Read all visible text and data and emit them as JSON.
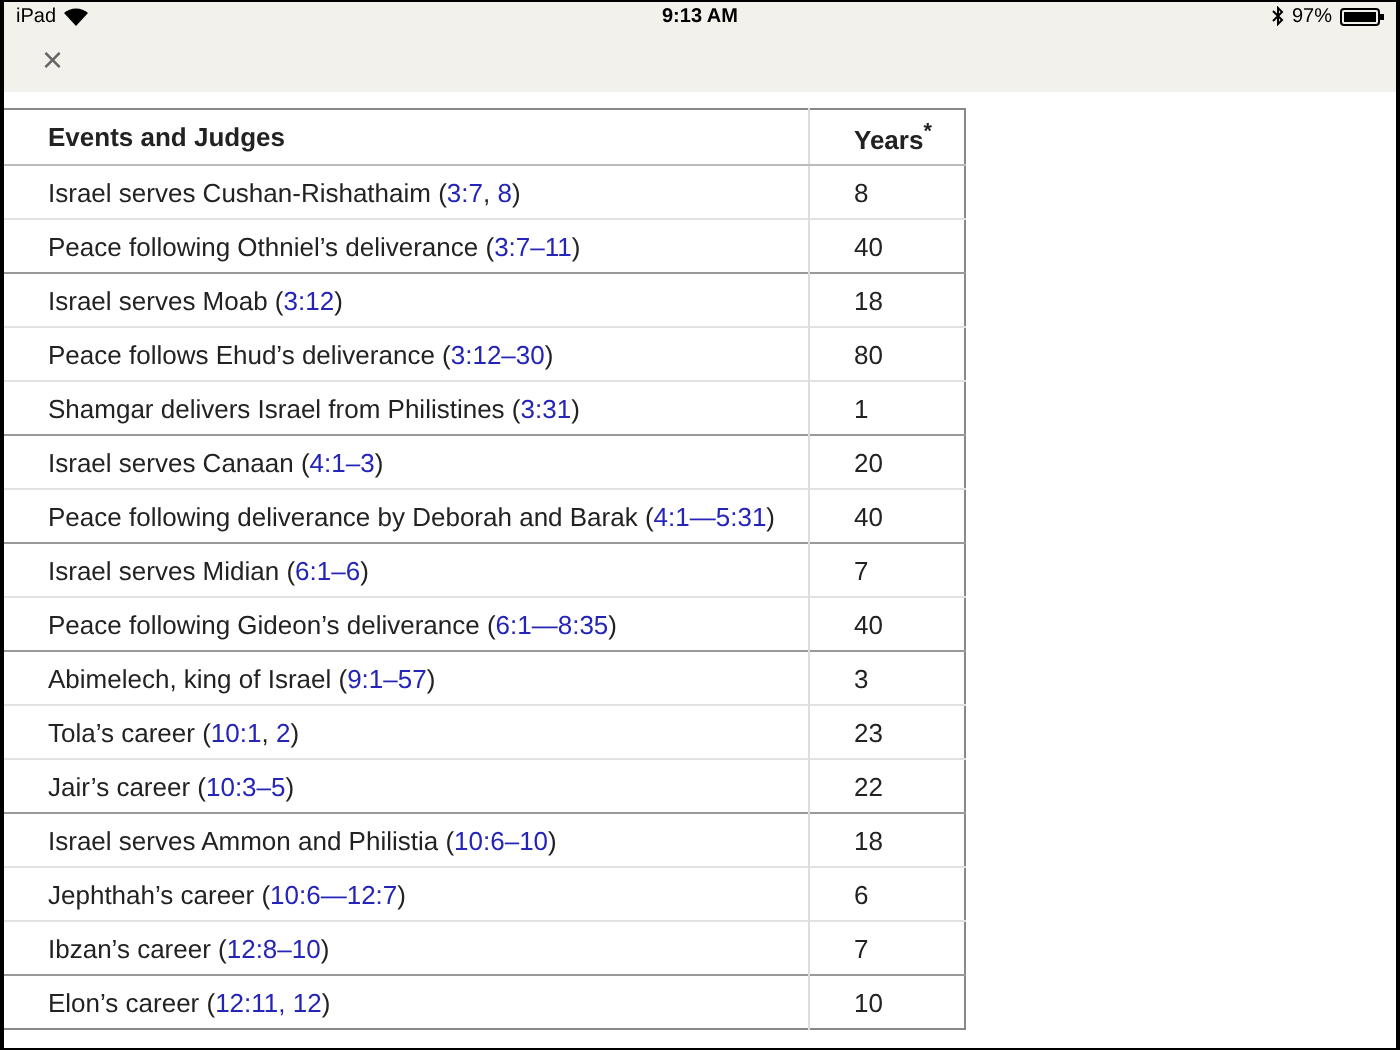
{
  "status_bar": {
    "device": "iPad",
    "time": "9:13 AM",
    "battery": "97%"
  },
  "toolbar": {
    "close": "×"
  },
  "table": {
    "columns": [
      "Events and Judges",
      "Years$^{*}$"
    ],
    "rows": [
      {
        "group_start": false,
        "event": [
          {
            "text": "Israel serves Cushan-Rishathaim ("
          },
          {
            "link": "3:7"
          },
          {
            "text": ", "
          },
          {
            "link": "8"
          },
          {
            "text": ")"
          }
        ],
        "years": "8"
      },
      {
        "group_start": false,
        "event": [
          {
            "text": "Peace following Othniel’s deliverance ("
          },
          {
            "link": "3:7–11"
          },
          {
            "text": ")"
          }
        ],
        "years": "40"
      },
      {
        "group_start": true,
        "event": [
          {
            "text": "Israel serves Moab ("
          },
          {
            "link": "3:12"
          },
          {
            "text": ")"
          }
        ],
        "years": "18"
      },
      {
        "group_start": false,
        "event": [
          {
            "text": "Peace follows Ehud’s deliverance ("
          },
          {
            "link": "3:12–30"
          },
          {
            "text": ")"
          }
        ],
        "years": "80"
      },
      {
        "group_start": false,
        "event": [
          {
            "text": "Shamgar delivers Israel from Philistines ("
          },
          {
            "link": "3:31"
          },
          {
            "text": ")"
          }
        ],
        "years": "1"
      },
      {
        "group_start": true,
        "event": [
          {
            "text": "Israel serves Canaan ("
          },
          {
            "link": "4:1–3"
          },
          {
            "text": ")"
          }
        ],
        "years": "20"
      },
      {
        "group_start": false,
        "event": [
          {
            "text": "Peace following deliverance by Deborah and Barak ("
          },
          {
            "link": "4:1—5:31"
          },
          {
            "text": ")"
          }
        ],
        "years": "40"
      },
      {
        "group_start": true,
        "event": [
          {
            "text": "Israel serves Midian ("
          },
          {
            "link": "6:1–6"
          },
          {
            "text": ")"
          }
        ],
        "years": "7"
      },
      {
        "group_start": false,
        "event": [
          {
            "text": "Peace following Gideon’s deliverance ("
          },
          {
            "link": "6:1—8:35"
          },
          {
            "text": ")"
          }
        ],
        "years": "40"
      },
      {
        "group_start": true,
        "event": [
          {
            "text": "Abimelech, king of Israel ("
          },
          {
            "link": "9:1–57"
          },
          {
            "text": ")"
          }
        ],
        "years": "3"
      },
      {
        "group_start": false,
        "event": [
          {
            "text": "Tola’s career ("
          },
          {
            "link": "10:1"
          },
          {
            "text": ", "
          },
          {
            "link": "2"
          },
          {
            "text": ")"
          }
        ],
        "years": "23"
      },
      {
        "group_start": false,
        "event": [
          {
            "text": "Jair’s career ("
          },
          {
            "link": "10:3–5"
          },
          {
            "text": ")"
          }
        ],
        "years": "22"
      },
      {
        "group_start": true,
        "event": [
          {
            "text": "Israel serves Ammon and Philistia ("
          },
          {
            "link": "10:6–10"
          },
          {
            "text": ")"
          }
        ],
        "years": "18"
      },
      {
        "group_start": false,
        "event": [
          {
            "text": "Jephthah’s career ("
          },
          {
            "link": "10:6—12:7"
          },
          {
            "text": ")"
          }
        ],
        "years": "6"
      },
      {
        "group_start": false,
        "event": [
          {
            "text": "Ibzan’s career ("
          },
          {
            "link": "12:8–10"
          },
          {
            "text": ")"
          }
        ],
        "years": "7"
      },
      {
        "group_start": true,
        "event": [
          {
            "text": "Elon’s career ("
          },
          {
            "link": "12:11, 12"
          },
          {
            "text": ")"
          }
        ],
        "years": "10"
      }
    ]
  }
}
